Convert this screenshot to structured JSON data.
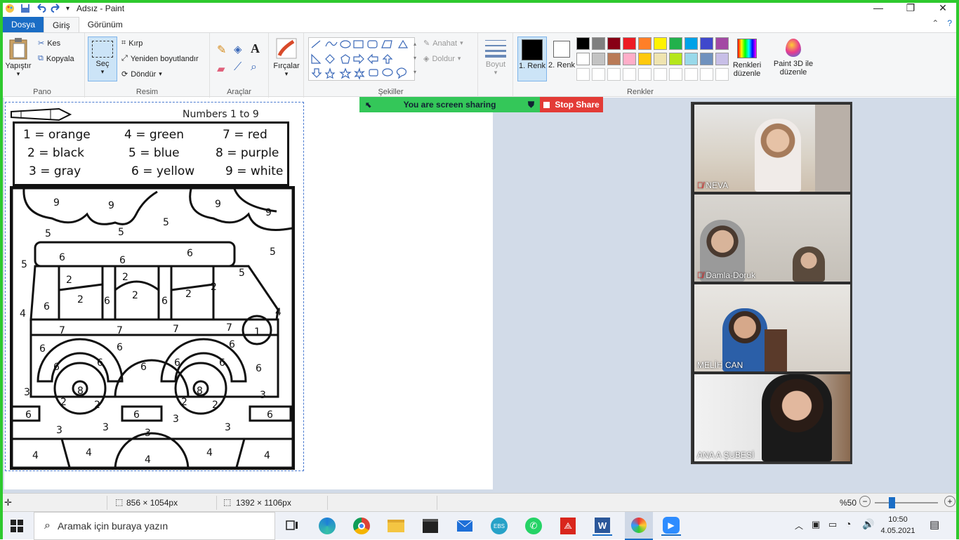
{
  "window": {
    "title": "Adsız - Paint"
  },
  "tabs": {
    "file": "Dosya",
    "home": "Giriş",
    "view": "Görünüm"
  },
  "clipboard": {
    "paste": "Yapıştır",
    "cut": "Kes",
    "copy": "Kopyala",
    "label": "Pano"
  },
  "image": {
    "select": "Seç",
    "crop": "Kırp",
    "resize": "Yeniden boyutlandır",
    "rotate": "Döndür",
    "label": "Resim"
  },
  "tools": {
    "label": "Araçlar"
  },
  "brushes": {
    "label": "Fırçalar"
  },
  "shapes": {
    "outline": "Anahat",
    "fill": "Doldur",
    "label": "Şekiller"
  },
  "size": {
    "label": "Boyut"
  },
  "colors": {
    "color1": "1. Renk",
    "color2": "2. Renk",
    "edit": "Renkleri düzenle",
    "paint3d": "Paint 3D ile düzenle",
    "label": "Renkler",
    "palette_row1": [
      "#000000",
      "#7f7f7f",
      "#880015",
      "#ed1c24",
      "#ff7f27",
      "#fff200",
      "#22b14c",
      "#00a2e8",
      "#3f48cc",
      "#a349a4"
    ],
    "palette_row2": [
      "#ffffff",
      "#c3c3c3",
      "#b97a57",
      "#ffaec9",
      "#ffc90e",
      "#efe4b0",
      "#b5e61d",
      "#99d9ea",
      "#7092be",
      "#c8bfe7"
    ]
  },
  "worksheet": {
    "subtitle": "Numbers 1 to 9",
    "key": [
      "1 = orange",
      "4 = green",
      "7 = red",
      "2 = black",
      "5 = blue",
      "8 = purple",
      "3 = gray",
      "6 = yellow",
      "9 = white"
    ]
  },
  "share": {
    "status": "You are screen sharing",
    "stop": "Stop Share"
  },
  "participants": [
    {
      "name": "NEVA"
    },
    {
      "name": "Damla-Doruk"
    },
    {
      "name": "MELİH CAN"
    },
    {
      "name": "ANA A ŞUBESİ"
    }
  ],
  "status": {
    "selection_size": "856 × 1054px",
    "image_size": "1392 × 1106px",
    "zoom": "%50"
  },
  "taskbar": {
    "search_placeholder": "Aramak için buraya yazın",
    "time": "10:50",
    "date": "4.05.2021"
  }
}
